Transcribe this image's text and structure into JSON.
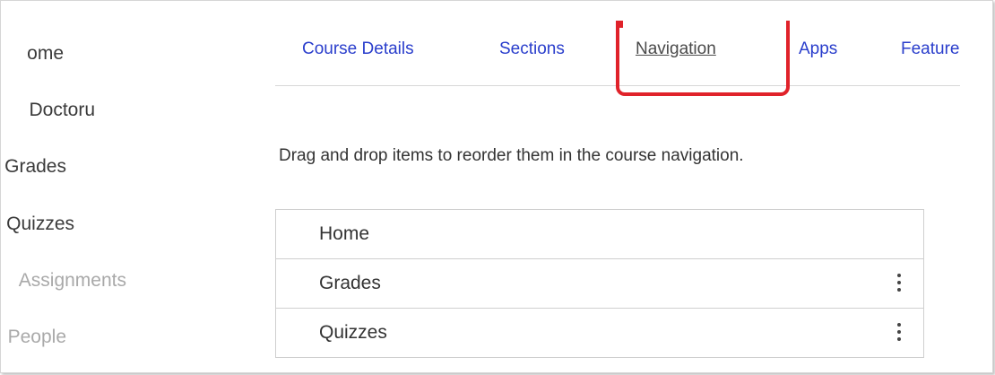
{
  "left_nav": {
    "items": [
      {
        "label": "ome"
      },
      {
        "label": "Doctoru"
      },
      {
        "label": "Grades"
      },
      {
        "label": "Quizzes"
      },
      {
        "label": "Assignments"
      },
      {
        "label": "People"
      }
    ]
  },
  "tabs": [
    {
      "label": "Course Details"
    },
    {
      "label": "Sections"
    },
    {
      "label": "Navigation"
    },
    {
      "label": "Apps"
    },
    {
      "label": "Feature"
    }
  ],
  "instructions": "Drag and drop items to reorder them in the course navigation.",
  "navigation_items": [
    {
      "label": "Home"
    },
    {
      "label": "Grades"
    },
    {
      "label": "Quizzes"
    }
  ],
  "colors": {
    "link": "#2a3ecc",
    "highlight": "#e0222a"
  }
}
